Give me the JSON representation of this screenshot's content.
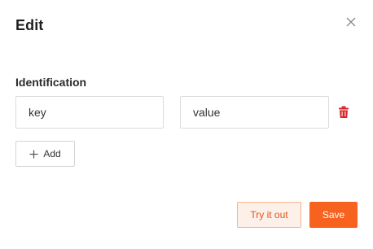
{
  "dialog": {
    "title": "Edit",
    "close_icon": "close-icon"
  },
  "identification": {
    "label": "Identification",
    "rows": [
      {
        "key_placeholder": "key",
        "key_value": "",
        "value_placeholder": "value",
        "value_value": "",
        "delete_icon": "trash-icon"
      }
    ],
    "add_label": "Add",
    "add_icon": "plus-icon"
  },
  "footer": {
    "try_label": "Try it out",
    "save_label": "Save"
  },
  "colors": {
    "accent": "#f7621f",
    "accent_light_bg": "#fdf0e8",
    "accent_border": "#f5b48f",
    "danger": "#d9262b"
  }
}
